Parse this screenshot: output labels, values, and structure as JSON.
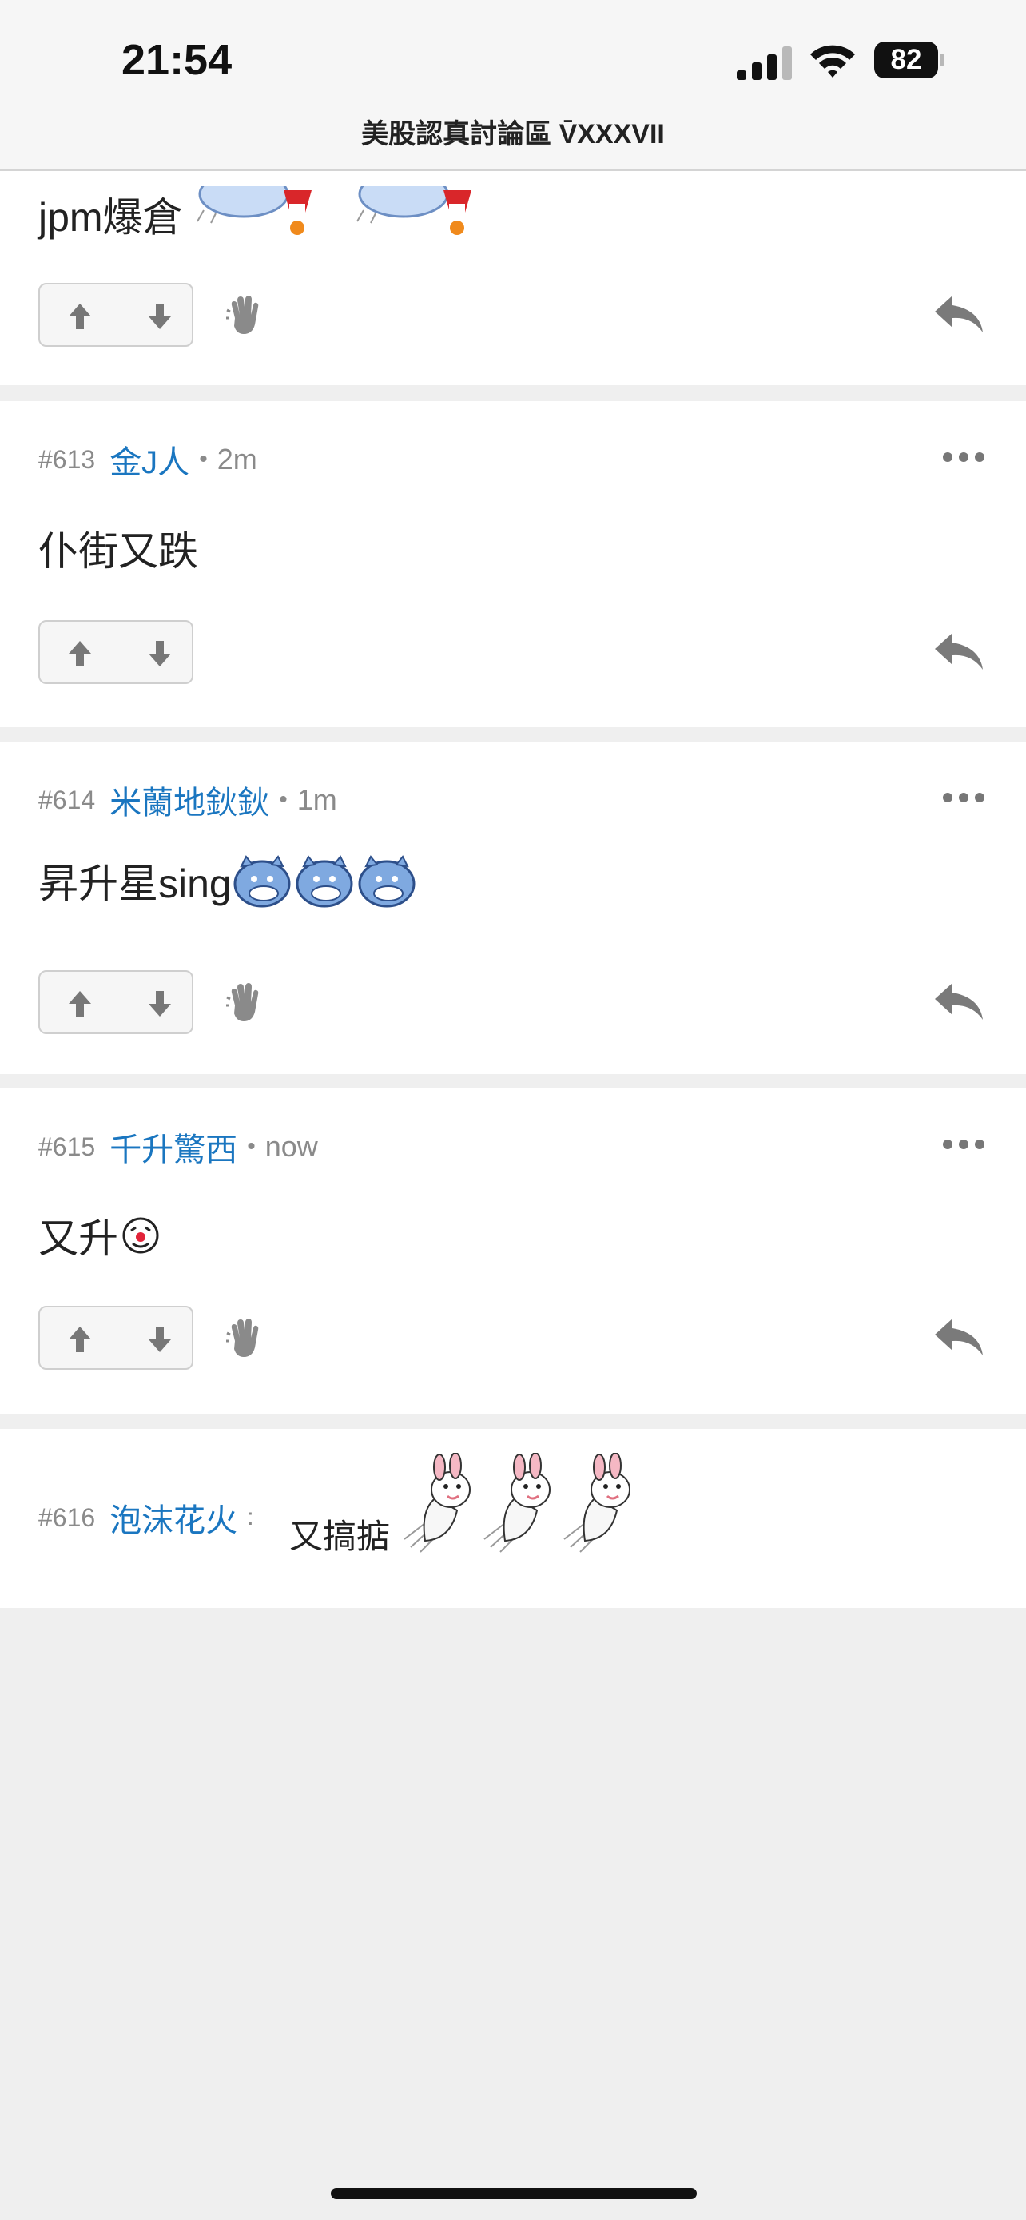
{
  "status_bar": {
    "time": "21:54",
    "battery": "82"
  },
  "header": {
    "thread_title": "美股認真討論區 V̄XXXVII"
  },
  "posts": [
    {
      "text": "jpm爆倉"
    },
    {
      "number": "#613",
      "author": "金J人",
      "separator": "•",
      "time": "2m",
      "text": "仆街又跌"
    },
    {
      "number": "#614",
      "author": "米蘭地鈥鈥",
      "separator": "•",
      "time": "1m",
      "text": "昇升星sing"
    },
    {
      "number": "#615",
      "author": "千升驚西",
      "separator": "•",
      "time": "now",
      "text": "又升"
    },
    {
      "number": "#616",
      "author": "泡沫花火",
      "separator": ":",
      "text": "又搞掂"
    }
  ],
  "icons": {
    "upvote": "arrow-up-icon",
    "downvote": "arrow-down-icon",
    "wave": "hand-wave-icon",
    "reply": "reply-arrow-icon",
    "more": "ellipsis-icon"
  },
  "colors": {
    "author": "#1a76c0",
    "meta": "#8a8a8a",
    "background": "#efefef"
  }
}
